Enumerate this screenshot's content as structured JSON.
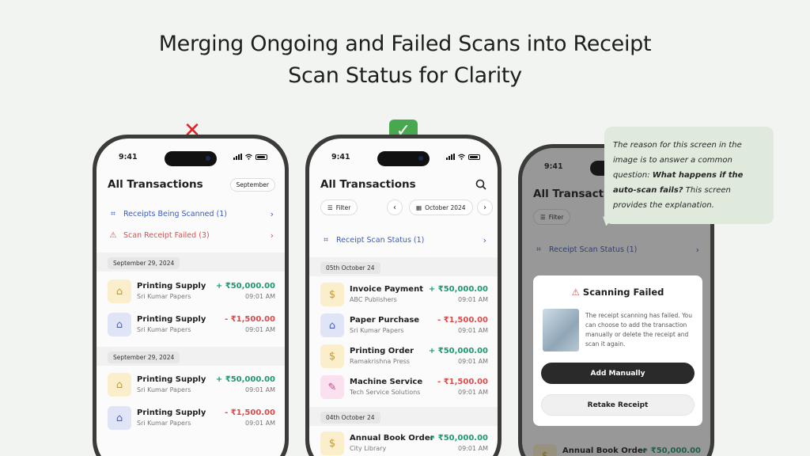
{
  "headline": {
    "line1": "Merging Ongoing and Failed Scans into Receipt",
    "line2": "Scan Status for Clarity"
  },
  "marks": {
    "wrong": "✕",
    "right": "✓"
  },
  "phone1": {
    "time": "9:41",
    "title": "All Transactions",
    "month": "September",
    "links": [
      {
        "label": "Receipts Being Scanned (1)",
        "icon": "scan-icon"
      },
      {
        "label": "Scan Receipt Failed (3)",
        "icon": "warning-icon"
      }
    ],
    "groups": [
      {
        "date": "September 29, 2024",
        "items": [
          {
            "name": "Printing Supply",
            "sub": "Sri Kumar Papers",
            "amount": "+ ₹50,000.00",
            "time": "09:01 AM",
            "type": "credit",
            "icon": "bag-icon"
          },
          {
            "name": "Printing Supply",
            "sub": "Sri Kumar Papers",
            "amount": "- ₹1,500.00",
            "time": "09:01 AM",
            "type": "debit",
            "icon": "bag-icon"
          }
        ]
      },
      {
        "date": "September 29, 2024",
        "items": [
          {
            "name": "Printing Supply",
            "sub": "Sri Kumar Papers",
            "amount": "+ ₹50,000.00",
            "time": "09:01 AM",
            "type": "credit",
            "icon": "bag-icon"
          },
          {
            "name": "Printing Supply",
            "sub": "Sri Kumar Papers",
            "amount": "- ₹1,500.00",
            "time": "09:01 AM",
            "type": "debit",
            "icon": "bag-icon"
          }
        ]
      }
    ]
  },
  "phone2": {
    "time": "9:41",
    "title": "All Transactions",
    "filter": "Filter",
    "month": "October 2024",
    "link": "Receipt Scan Status (1)",
    "groups": [
      {
        "date": "05th October 24",
        "items": [
          {
            "name": "Invoice Payment",
            "sub": "ABC Publishers",
            "amount": "+ ₹50,000.00",
            "time": "09:01 AM"
          },
          {
            "name": "Paper Purchase",
            "sub": "Sri Kumar Papers",
            "amount": "- ₹1,500.00",
            "time": "09:01 AM"
          },
          {
            "name": "Printing Order",
            "sub": "Ramakrishna Press",
            "amount": "+ ₹50,000.00",
            "time": "09:01 AM"
          },
          {
            "name": "Machine Service",
            "sub": "Tech Service Solutions",
            "amount": "- ₹1,500.00",
            "time": "09:01 AM"
          }
        ]
      },
      {
        "date": "04th October 24",
        "items": [
          {
            "name": "Annual Book Order",
            "sub": "City Library",
            "amount": "+ ₹50,000.00",
            "time": "09:01 AM"
          }
        ]
      }
    ]
  },
  "phone3": {
    "time": "9:41",
    "title": "All Transactions",
    "filter": "Filter",
    "link": "Receipt Scan Status (1)",
    "bottom_item": {
      "name": "Annual Book Order",
      "amount": "+ ₹50,000.00"
    },
    "modal": {
      "title": "Scanning Failed",
      "text": "The receipt scanning has failed. You can choose to add the transaction manually or delete the receipt and scan it again.",
      "primary": "Add Manually",
      "secondary": "Retake Receipt"
    }
  },
  "note": {
    "p1": "The reason for this screen in the image is to answer a common question: ",
    "bold": "What happens if the auto-scan fails?",
    "p2": " This screen provides the explanation."
  }
}
